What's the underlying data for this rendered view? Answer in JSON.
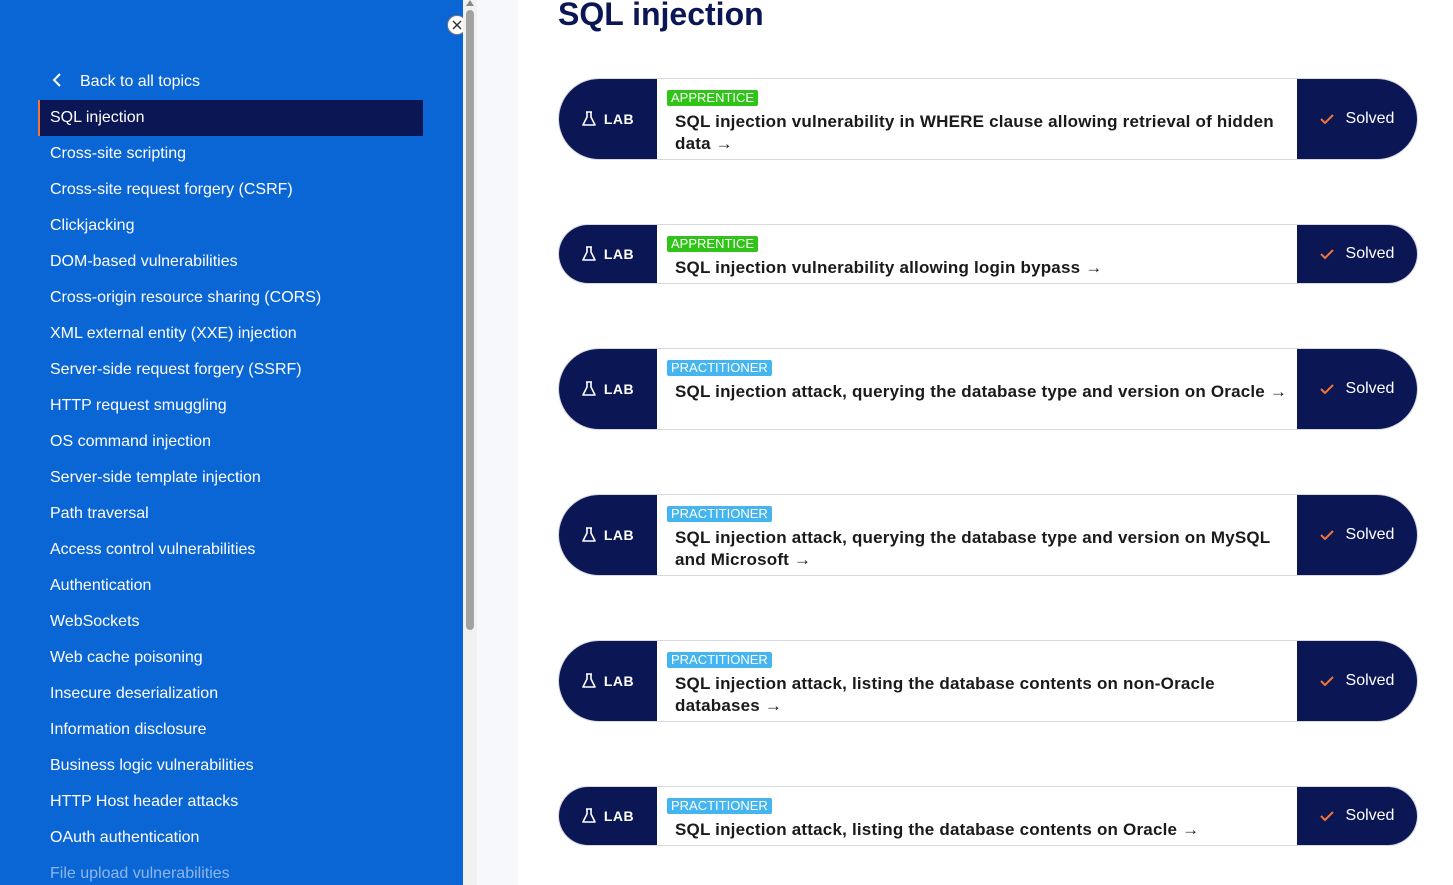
{
  "sidebar": {
    "back_label": "Back to all topics",
    "items": [
      {
        "label": "SQL injection",
        "active": true
      },
      {
        "label": "Cross-site scripting"
      },
      {
        "label": "Cross-site request forgery (CSRF)"
      },
      {
        "label": "Clickjacking"
      },
      {
        "label": "DOM-based vulnerabilities"
      },
      {
        "label": "Cross-origin resource sharing (CORS)"
      },
      {
        "label": "XML external entity (XXE) injection"
      },
      {
        "label": "Server-side request forgery (SSRF)"
      },
      {
        "label": "HTTP request smuggling"
      },
      {
        "label": "OS command injection"
      },
      {
        "label": "Server-side template injection"
      },
      {
        "label": "Path traversal"
      },
      {
        "label": "Access control vulnerabilities"
      },
      {
        "label": "Authentication"
      },
      {
        "label": "WebSockets"
      },
      {
        "label": "Web cache poisoning"
      },
      {
        "label": "Insecure deserialization"
      },
      {
        "label": "Information disclosure"
      },
      {
        "label": "Business logic vulnerabilities"
      },
      {
        "label": "HTTP Host header attacks"
      },
      {
        "label": "OAuth authentication"
      },
      {
        "label": "File upload vulnerabilities",
        "faded": true
      }
    ]
  },
  "main": {
    "title": "SQL injection",
    "lab_label": "LAB",
    "labs": [
      {
        "level": "APPRENTICE",
        "title": "SQL injection vulnerability in WHERE clause allowing retrieval of hidden data →",
        "status": "Solved"
      },
      {
        "level": "APPRENTICE",
        "title": "SQL injection vulnerability allowing login bypass →",
        "status": "Solved"
      },
      {
        "level": "PRACTITIONER",
        "title": "SQL injection attack, querying the database type and version on Oracle →",
        "status": "Solved"
      },
      {
        "level": "PRACTITIONER",
        "title": "SQL injection attack, querying the database type and version on MySQL and Microsoft →",
        "status": "Solved"
      },
      {
        "level": "PRACTITIONER",
        "title": "SQL injection attack, listing the database contents on non-Oracle databases →",
        "status": "Solved"
      },
      {
        "level": "PRACTITIONER",
        "title": "SQL injection attack, listing the database contents on Oracle →",
        "status": "Solved"
      }
    ]
  },
  "colors": {
    "sidebar_bg": "#0a66d5",
    "navy": "#0b1654",
    "apprentice": "#2fc417",
    "practitioner": "#45b5f0",
    "accent": "#f57435"
  },
  "icons": {
    "back": "chevron-left-icon",
    "close": "close-icon",
    "lab": "flask-icon",
    "solved": "checkmark-icon"
  }
}
